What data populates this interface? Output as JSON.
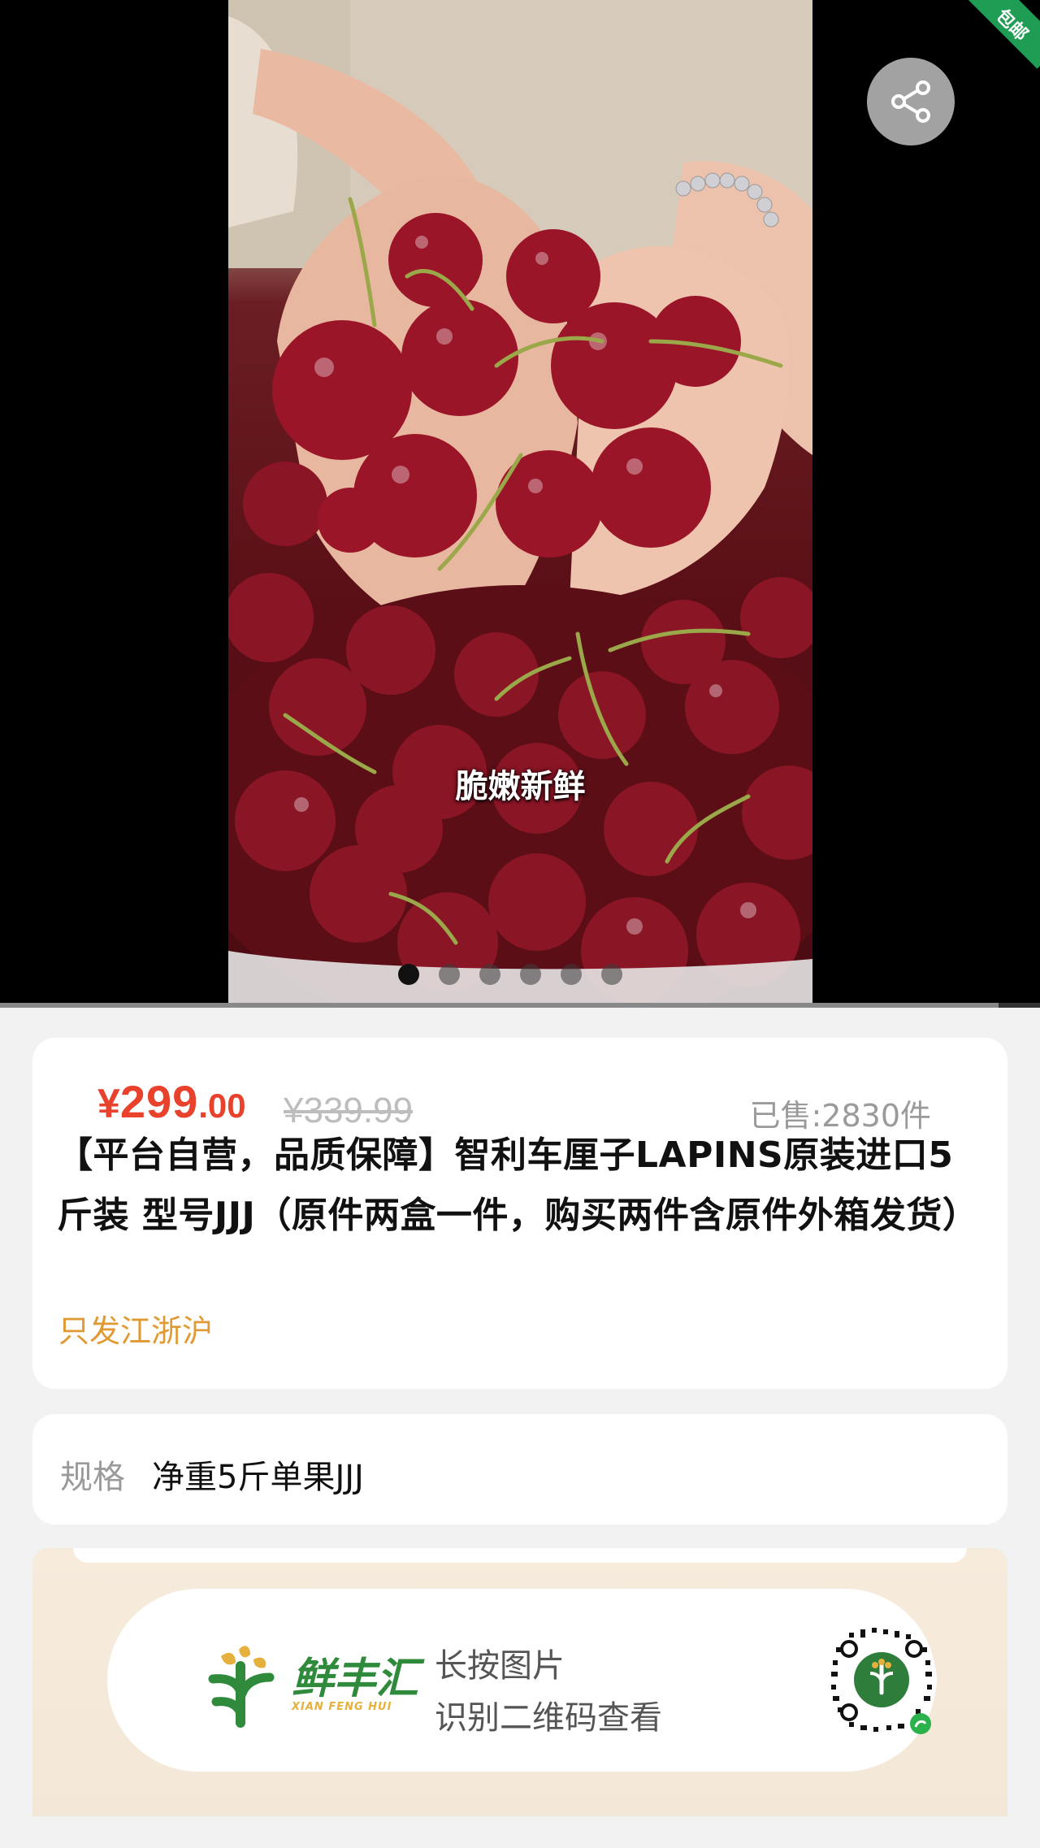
{
  "media": {
    "caption": "脆嫩新鲜",
    "corner_ribbon": "包邮",
    "share_icon": "share-icon",
    "carousel_count": 6,
    "carousel_active": 1,
    "video_progress": 0.96
  },
  "product": {
    "price_symbol": "¥",
    "price_int": "299",
    "price_dec": ".00",
    "original_price": "¥339.99",
    "sold_label": "已售:2830件",
    "title": "【平台自营，品质保障】智利车厘子LAPINS原装进口5斤装 型号JJJ（原件两盒一件，购买两件含原件外箱发货）",
    "region_note": "只发江浙沪"
  },
  "spec": {
    "label": "规格",
    "value": "净重5斤单果JJJ"
  },
  "promo": {
    "brand_name": "鲜丰汇",
    "brand_pinyin": "XIAN FENG HUI",
    "line1": "长按图片",
    "line2": "识别二维码查看",
    "qr_icon": "qr-code-icon"
  },
  "colors": {
    "price": "#e8412c",
    "region": "#e19a33",
    "brand_green": "#2f8a3b",
    "brand_orange": "#e6b03d"
  }
}
